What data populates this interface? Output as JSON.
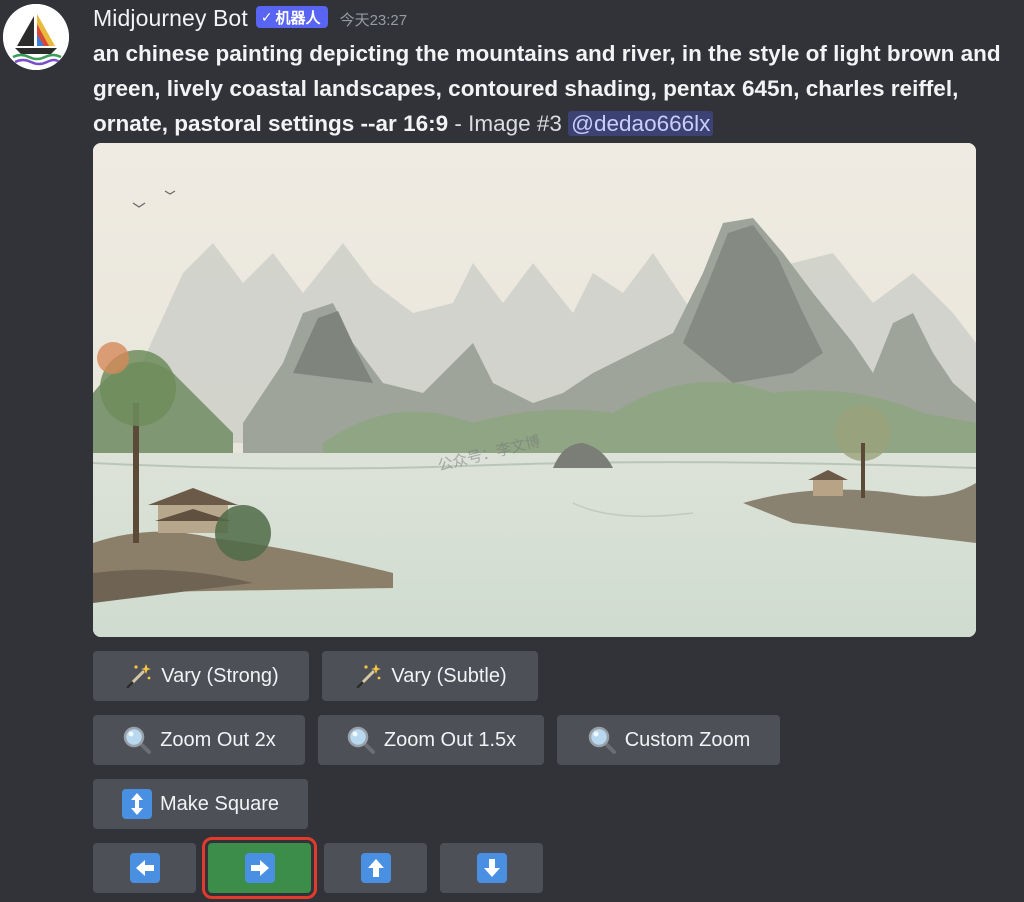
{
  "author": {
    "name": "Midjourney Bot",
    "badge_label": "机器人",
    "timestamp": "今天23:27"
  },
  "message": {
    "prompt": "an chinese painting depicting the mountains and river, in the style of light brown and green, lively coastal landscapes, contoured shading, pentax 645n, charles reiffel, ornate, pastoral settings --ar 16:9",
    "suffix": " - Image #3 ",
    "mention": "@dedao666lx"
  },
  "image": {
    "watermark": "公众号：李文博"
  },
  "buttons": {
    "vary_strong": "Vary (Strong)",
    "vary_subtle": "Vary (Subtle)",
    "zoom_out_2x": "Zoom Out 2x",
    "zoom_out_15x": "Zoom Out 1.5x",
    "custom_zoom": "Custom Zoom",
    "make_square": "Make Square"
  },
  "icons": {
    "vary": "magic-wand-icon",
    "zoom": "magnifier-icon",
    "square": "up-down-arrow-icon",
    "pan_left": "arrow-left-icon",
    "pan_right": "arrow-right-icon",
    "pan_up": "arrow-up-icon",
    "pan_down": "arrow-down-icon"
  },
  "colors": {
    "background": "#323338",
    "button": "#4e5058",
    "selected_button": "#3c8c4a",
    "highlight_outline": "#e23b2c",
    "bot_badge": "#5865f2",
    "arrow_key": "#4a90e2"
  },
  "pan": {
    "selected": "right"
  }
}
